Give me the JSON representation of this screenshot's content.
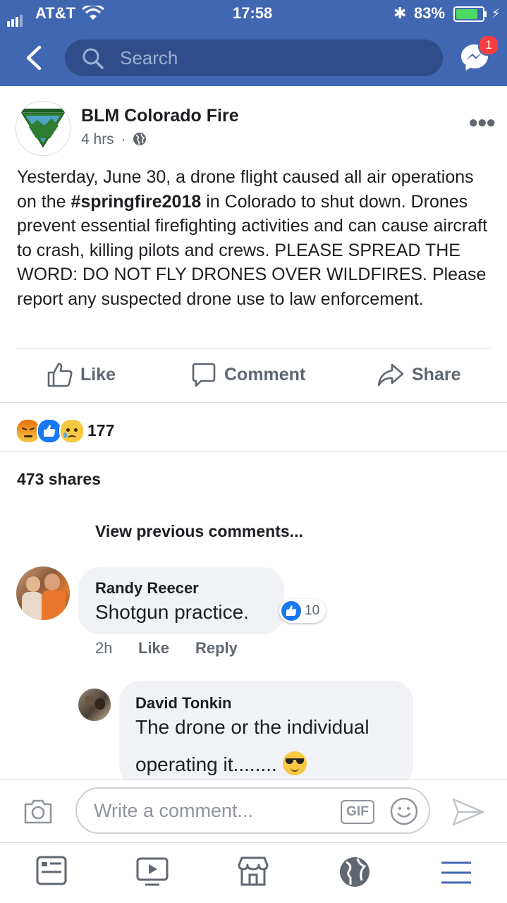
{
  "status_bar": {
    "carrier": "AT&T",
    "time": "17:58",
    "battery": "83%"
  },
  "nav": {
    "search_placeholder": "Search",
    "messenger_badge": "1"
  },
  "post": {
    "author": "BLM Colorado Fire",
    "time": "4 hrs",
    "text_before": "Yesterday, June 30, a drone flight caused all air operations on the ",
    "hashtag": "#springfire2018",
    "text_after": " in Colorado to shut down. Drones prevent essential firefighting activities and can cause aircraft to crash, killing pilots and crews. PLEASE SPREAD THE WORD: DO NOT FLY DRONES OVER WILDFIRES. Please report any suspected drone use to law enforcement.",
    "actions": {
      "like": "Like",
      "comment": "Comment",
      "share": "Share"
    },
    "reaction_count": "177",
    "shares": "473 shares"
  },
  "comments": {
    "view_previous": "View previous comments...",
    "items": [
      {
        "author": "Randy Reecer",
        "text": "Shotgun practice.",
        "likes": "10",
        "age": "2h",
        "like": "Like",
        "reply": "Reply"
      },
      {
        "author": "David Tonkin",
        "text_line1": "The drone or the individual",
        "text_line2": "operating it........"
      }
    ]
  },
  "composer": {
    "placeholder": "Write a comment...",
    "gif": "GIF"
  },
  "colors": {
    "brand": "#4267b2",
    "like_blue": "#1877f2",
    "notification": "#fa3e3e"
  },
  "tab_icons": [
    "news-feed-icon",
    "watch-icon",
    "marketplace-icon",
    "globe-icon",
    "menu-icon"
  ]
}
